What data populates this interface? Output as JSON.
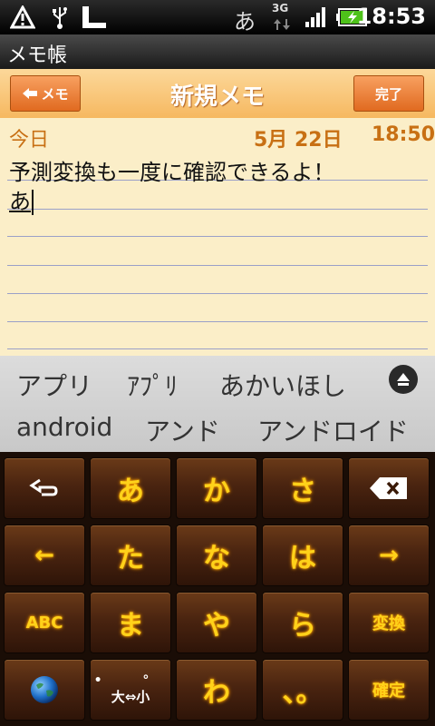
{
  "status_bar": {
    "ime_indicator": "あ",
    "network": "3G",
    "time": "18:53",
    "icons": [
      "warning-icon",
      "usb-icon",
      "sd-card-icon",
      "signal-icon",
      "battery-charging-icon"
    ]
  },
  "app": {
    "title": "メモ帳"
  },
  "memo_header": {
    "back_label": "メモ",
    "title": "新規メモ",
    "done_label": "完了"
  },
  "memo": {
    "date_label": "今日",
    "date": "5月 22日",
    "time": "18:50",
    "lines": [
      "予測変換も一度に確認できるよ！",
      "あ"
    ]
  },
  "candidates": {
    "row1": [
      "アプリ",
      "ｱﾌﾟﾘ",
      "あかいほし"
    ],
    "row2": [
      "android",
      "アンド",
      "アンドロイド"
    ]
  },
  "keyboard": {
    "rows": [
      [
        "undo",
        "あ",
        "か",
        "さ",
        "backspace"
      ],
      [
        "←",
        "た",
        "な",
        "は",
        "→"
      ],
      [
        "ABC",
        "ま",
        "や",
        "ら",
        "変換"
      ],
      [
        "globe",
        "大⇔小",
        "わ",
        "、。",
        "確定"
      ]
    ],
    "labels": {
      "left": "←",
      "right": "→",
      "abc": "ABC",
      "convert": "変換",
      "size_toggle": "大⇔小",
      "punct": "、。",
      "confirm": "確定",
      "a": "あ",
      "ka": "か",
      "sa": "さ",
      "ta": "た",
      "na": "な",
      "ha": "は",
      "ma": "ま",
      "ya": "や",
      "ra": "ら",
      "wa": "わ"
    }
  },
  "colors": {
    "key_text": "#ffd21a",
    "header_orange": "#f6b860",
    "button_orange": "#e06a20",
    "paper": "#fbeec8",
    "date_text": "#c87014"
  }
}
